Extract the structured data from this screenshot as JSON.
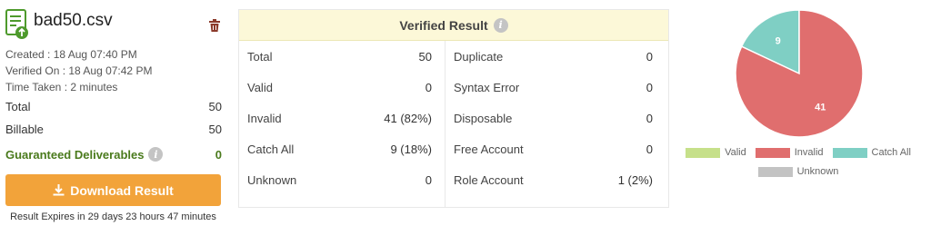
{
  "file": {
    "name": "bad50.csv",
    "created": "Created : 18 Aug 07:40 PM",
    "verified_on": "Verified On : 18 Aug 07:42 PM",
    "time_taken": "Time Taken : 2 minutes"
  },
  "summary": {
    "total_label": "Total",
    "total_value": "50",
    "billable_label": "Billable",
    "billable_value": "50",
    "guaranteed_label": "Guaranteed Deliverables",
    "guaranteed_value": "0"
  },
  "download": {
    "label": "Download Result",
    "expires": "Result Expires in 29 days 23 hours 47 minutes"
  },
  "result": {
    "title": "Verified Result",
    "left_rows": [
      {
        "label": "Total",
        "value": "50"
      },
      {
        "label": "Valid",
        "value": "0"
      },
      {
        "label": "Invalid",
        "value": "41 (82%)"
      },
      {
        "label": "Catch All",
        "value": "9 (18%)"
      },
      {
        "label": "Unknown",
        "value": "0"
      }
    ],
    "right_rows": [
      {
        "label": "Duplicate",
        "value": "0"
      },
      {
        "label": "Syntax Error",
        "value": "0"
      },
      {
        "label": "Disposable",
        "value": "0"
      },
      {
        "label": "Free Account",
        "value": "0"
      },
      {
        "label": "Role Account",
        "value": "1 (2%)"
      }
    ]
  },
  "colors": {
    "valid": "#c6e08a",
    "invalid": "#e06e6e",
    "catch_all": "#7fcfc4",
    "unknown": "#c3c3c3",
    "accent": "#f2a33a",
    "guaranteed": "#4a7a1c"
  },
  "chart_data": {
    "type": "pie",
    "categories": [
      "Valid",
      "Invalid",
      "Catch All",
      "Unknown"
    ],
    "values": [
      0,
      41,
      9,
      0
    ],
    "data_labels": [
      "",
      "41",
      "9",
      ""
    ],
    "legend": "bottom"
  }
}
